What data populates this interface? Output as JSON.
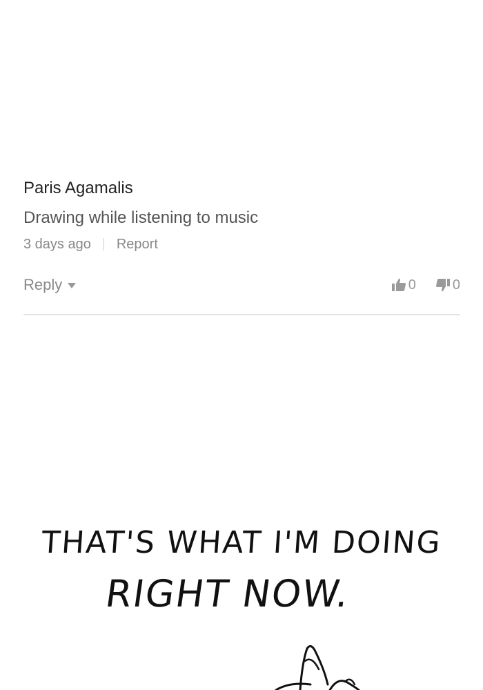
{
  "comment": {
    "author": "Paris Agamalis",
    "text": "Drawing while listening to music",
    "timestamp": "3 days ago",
    "report_label": "Report",
    "reply_label": "Reply",
    "likes": "0",
    "dislikes": "0",
    "icons": {
      "reply_toggle": "chevron-down-icon",
      "like": "thumbs-up-icon",
      "dislike": "thumbs-down-icon"
    }
  },
  "caption": {
    "line1": "THAT'S WHAT I'M DOING",
    "line2": "RIGHT NOW."
  }
}
